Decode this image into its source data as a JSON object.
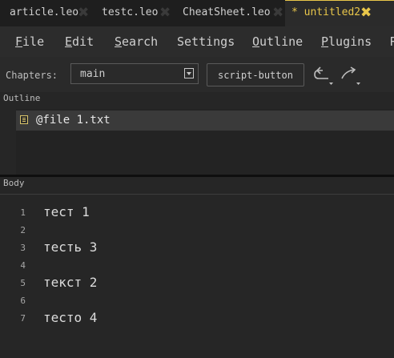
{
  "tabs": [
    {
      "label": "article.leo"
    },
    {
      "label": "testc.leo"
    },
    {
      "label": "CheatSheet.leo"
    },
    {
      "label": "* untitled2"
    }
  ],
  "menu": [
    {
      "label": "File",
      "mnemonic": "F",
      "rest": "ile"
    },
    {
      "label": "Edit",
      "mnemonic": "E",
      "rest": "dit"
    },
    {
      "label": "Search",
      "mnemonic": "S",
      "rest": "earch"
    },
    {
      "label": "Settings",
      "mnemonic": "",
      "rest": "Settings"
    },
    {
      "label": "Outline",
      "mnemonic": "O",
      "rest": "utline"
    },
    {
      "label": "Plugins",
      "mnemonic": "P",
      "rest": "lugins"
    },
    {
      "label": "R",
      "mnemonic": "",
      "rest": "R"
    }
  ],
  "toolbar": {
    "chapters_label": "Chapters:",
    "chapter_value": "main",
    "script_button": "script-button"
  },
  "outline": {
    "label": "Outline",
    "nodes": [
      {
        "label": "@file 1.txt"
      }
    ]
  },
  "body": {
    "label": "Body",
    "lines": [
      {
        "n": "1",
        "text": "тест 1"
      },
      {
        "n": "2",
        "text": ""
      },
      {
        "n": "3",
        "text": "тесть 3"
      },
      {
        "n": "4",
        "text": ""
      },
      {
        "n": "5",
        "text": "текст 2"
      },
      {
        "n": "6",
        "text": ""
      },
      {
        "n": "7",
        "text": "тесто 4"
      }
    ]
  },
  "colors": {
    "accent": "#e8c64a",
    "background": "#262626"
  },
  "icons": [
    "close-icon",
    "dropdown-arrow-icon",
    "undo-icon",
    "redo-icon",
    "node-icon"
  ]
}
